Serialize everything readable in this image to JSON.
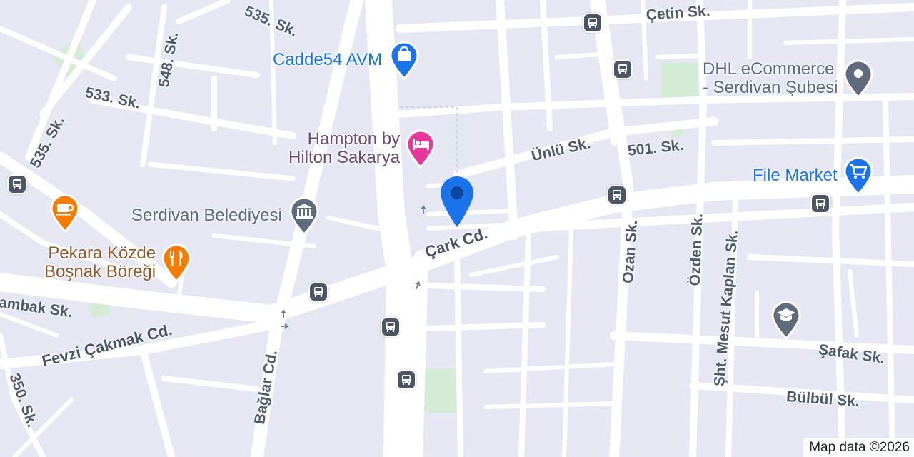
{
  "map": {
    "background_color": "#e5e8f3",
    "road_color": "#ffffff",
    "park_color": "#d4ecd6",
    "label_color": "#4f5b6b",
    "attribution": "Map data ©2026"
  },
  "streets": [
    {
      "name": "535. Sk.",
      "key": "s535a"
    },
    {
      "name": "548. Sk.",
      "key": "s548"
    },
    {
      "name": "533. Sk.",
      "key": "s533"
    },
    {
      "name": "535. Sk.",
      "key": "s535b"
    },
    {
      "name": "Çetin Sk.",
      "key": "cetin"
    },
    {
      "name": "Ünlü Sk.",
      "key": "unlu"
    },
    {
      "name": "501. Sk.",
      "key": "s501"
    },
    {
      "name": "Çark Cd.",
      "key": "cark"
    },
    {
      "name": "Ozan Sk.",
      "key": "ozan"
    },
    {
      "name": "Özden Sk.",
      "key": "ozden"
    },
    {
      "name": "Şht. Mesut Kaplan Sk.",
      "key": "mesut"
    },
    {
      "name": "Şafak Sk.",
      "key": "safak"
    },
    {
      "name": "Bülbül Sk.",
      "key": "bulbul"
    },
    {
      "name": "Fevzi Çakmak Cd.",
      "key": "fevzi"
    },
    {
      "name": "Bağlar Cd.",
      "key": "baglar"
    },
    {
      "name": "350. Sk.",
      "key": "s350"
    },
    {
      "name": "ambak Sk.",
      "key": "ambak"
    }
  ],
  "pois": [
    {
      "name": "Cadde54 AVM",
      "icon": "shopping-bag-icon",
      "color": "#1a73e8"
    },
    {
      "name_line1": "Hampton by",
      "name_line2": "Hilton Sakarya",
      "icon": "hotel-bed-icon",
      "color": "#e8379b"
    },
    {
      "name": "Serdivan Belediyesi",
      "icon": "government-building-icon",
      "color": "#5f6b7a"
    },
    {
      "name_line1": "Pekara Közde",
      "name_line2": "Boşnak Böreği",
      "icon": "restaurant-icon",
      "color": "#f57c00"
    },
    {
      "name_line1": "DHL eCommerce",
      "name_line2": "- Serdivan Şubesi",
      "icon": "place-icon",
      "color": "#5f6b7a"
    },
    {
      "name": "File Market",
      "icon": "shopping-cart-icon",
      "color": "#1a73e8"
    },
    {
      "name": "",
      "icon": "cafe-icon",
      "color": "#f57c00"
    },
    {
      "name": "",
      "icon": "school-icon",
      "color": "#5f6b7a"
    }
  ],
  "location_pin": {
    "icon": "location-pin-icon",
    "color": "#1a73e8"
  },
  "bus_stop_icon": "bus-stop-icon"
}
